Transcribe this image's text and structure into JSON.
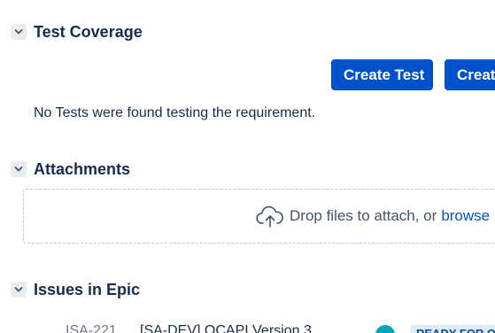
{
  "test_coverage": {
    "title": "Test Coverage",
    "create_test_label": "Create Test",
    "create_second_label": "Create",
    "empty_message": "No Tests were found testing the requirement."
  },
  "attachments": {
    "title": "Attachments",
    "drop_text": "Drop files to attach, or",
    "browse_label": "browse"
  },
  "issues_in_epic": {
    "title": "Issues in Epic",
    "issues": [
      {
        "key": "ISA-221",
        "summary": "[SA-DEV] OCAPI Version 3",
        "status": "READY FOR Q"
      }
    ]
  },
  "colors": {
    "primary": "#0052cc",
    "text": "#172b4d",
    "muted": "#6b778c",
    "status_bg": "#deebff",
    "status_text": "#0747a6",
    "avatar": "#00a3bf"
  }
}
